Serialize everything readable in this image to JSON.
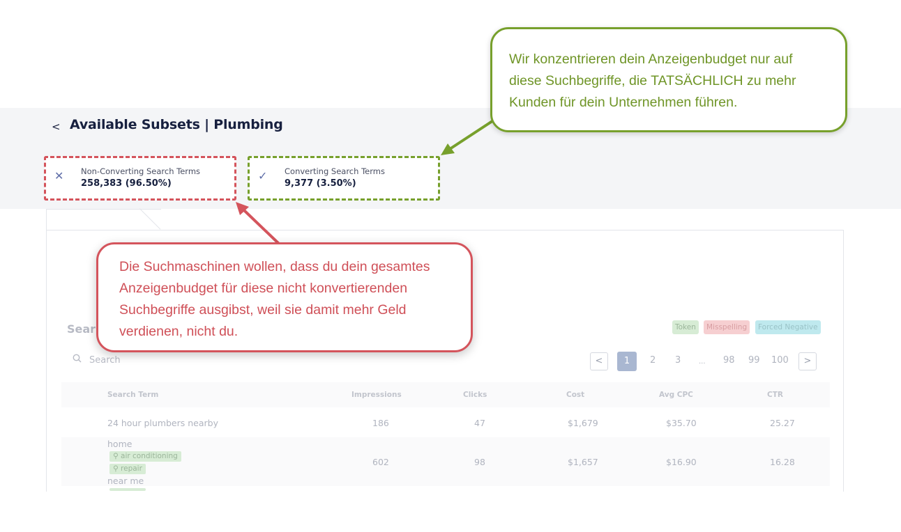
{
  "header": {
    "title": "Available Subsets | Plumbing",
    "back_glyph": "<"
  },
  "subsets": [
    {
      "icon": "close-icon",
      "glyph": "✕",
      "label": "Non-Converting Search Terms",
      "value": "258,383 (96.50%)"
    },
    {
      "icon": "check-icon",
      "glyph": "✓",
      "label": "Converting Search Terms",
      "value": "9,377 (3.50%)"
    }
  ],
  "section": {
    "title": "Sear"
  },
  "legend": {
    "token": "Token",
    "misspelling": "Misspelling",
    "forced_negative": "Forced Negative"
  },
  "search": {
    "placeholder": "Search"
  },
  "pagination": {
    "prev": "<",
    "next": ">",
    "pages": [
      "1",
      "2",
      "3",
      "...",
      "98",
      "99",
      "100"
    ],
    "active": "1"
  },
  "table": {
    "columns": [
      "Search Term",
      "Impressions",
      "Clicks",
      "Cost",
      "Avg CPC",
      "CTR"
    ],
    "rows": [
      {
        "term": "24 hour plumbers nearby",
        "impressions": "186",
        "clicks": "47",
        "cost": "$1,679",
        "avg_cpc": "$35.70",
        "ctr": "25.27"
      },
      {
        "term": "home",
        "chips": [
          "air conditioning",
          "repair"
        ],
        "term_tail": "near me",
        "impressions": "602",
        "clicks": "98",
        "cost": "$1,657",
        "avg_cpc": "$16.90",
        "ctr": "16.28"
      }
    ]
  },
  "callouts": {
    "green": [
      "Wir konzentrieren dein Anzeigenbudget nur auf",
      "diese Suchbegriffe, die TATSÄCHLICH zu mehr",
      "Kunden für dein Unternehmen führen."
    ],
    "red": [
      "Die Suchmaschinen wollen, dass du dein gesamtes",
      "Anzeigenbudget für diese nicht konvertierenden",
      "Suchbegriffe ausgibst, weil sie damit mehr Geld",
      "verdienen, nicht du."
    ]
  },
  "colors": {
    "accent_green": "#77a02c",
    "accent_red": "#d4545c",
    "title": "#17203f",
    "active_page": "#a9b7d1"
  }
}
